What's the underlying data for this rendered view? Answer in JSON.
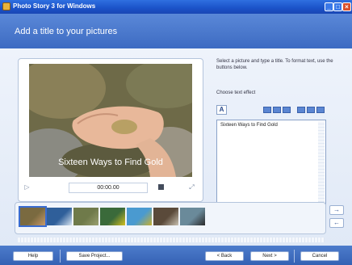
{
  "window": {
    "title": "Photo Story 3 for Windows",
    "minimize_glyph": "_",
    "maximize_glyph": "□",
    "close_glyph": "×"
  },
  "header": {
    "title": "Add a title to your pictures"
  },
  "preview": {
    "overlay_text": "Sixteen Ways to Find Gold",
    "time_value": "00:00.00",
    "play_icon": "play-icon",
    "stop_icon": "stop-icon"
  },
  "text_panel": {
    "instructions": "Select a picture and type a title. To format text, use the buttons below.",
    "font_label": "Choose text effect",
    "text_value": "Sixteen Ways to Find Gold",
    "font_button": "A"
  },
  "filmstrip": {
    "thumbnails": [
      {
        "name": "thumb-1",
        "color": "#7a6a40",
        "accent": "#c89a6a"
      },
      {
        "name": "thumb-2",
        "color": "#2f5f9a",
        "accent": "#d8e4f0"
      },
      {
        "name": "thumb-3",
        "color": "#6f7a4a",
        "accent": "#9aa070"
      },
      {
        "name": "thumb-4",
        "color": "#3a6a3a",
        "accent": "#d4c020"
      },
      {
        "name": "thumb-5",
        "color": "#4a9ad0",
        "accent": "#c8b030"
      },
      {
        "name": "thumb-6",
        "color": "#5a4a3a",
        "accent": "#c8c0b0"
      },
      {
        "name": "thumb-7",
        "color": "#6a8a9a",
        "accent": "#2a2a2a"
      }
    ],
    "move_left_glyph": "←",
    "move_right_glyph": "→"
  },
  "footer": {
    "help": "Help",
    "save_project": "Save Project...",
    "back": "< Back",
    "next": "Next >",
    "cancel": "Cancel"
  },
  "colors": {
    "header": "#3d6bc2",
    "accent": "#3a6cd0",
    "footer": "#3461b4"
  }
}
